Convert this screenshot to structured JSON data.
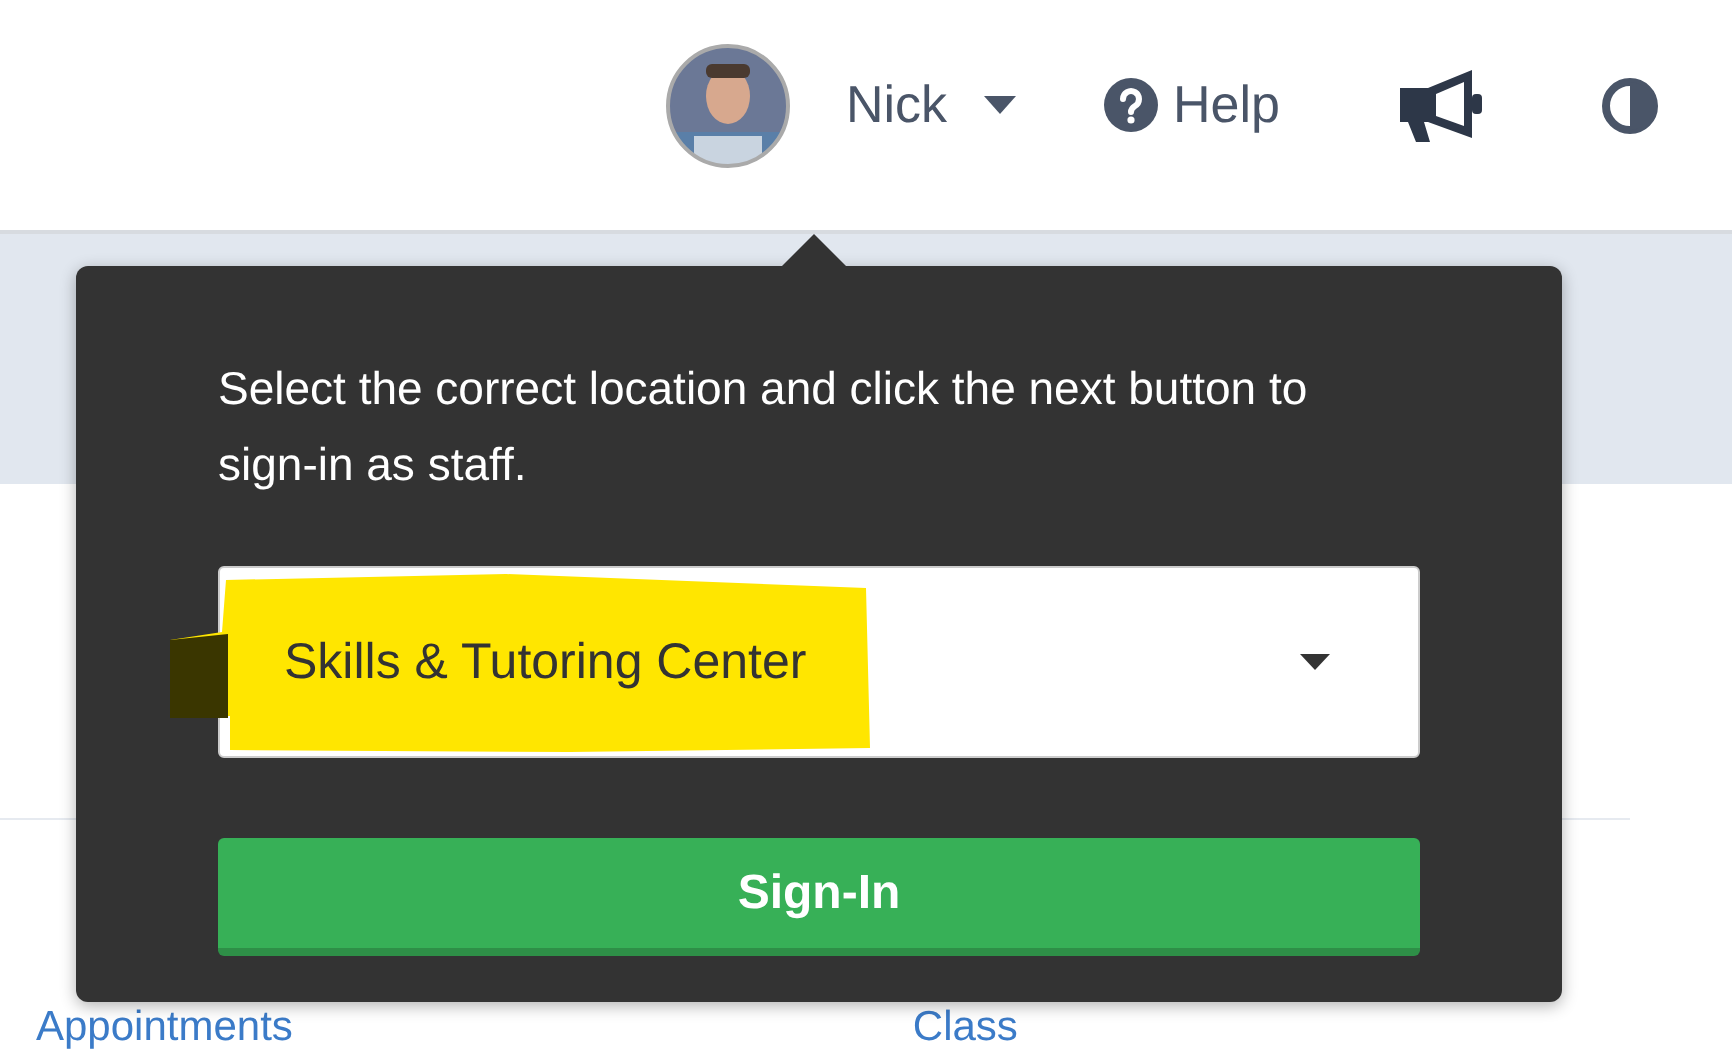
{
  "header": {
    "user": {
      "name": "Nick"
    },
    "help": {
      "label": "Help"
    }
  },
  "popup": {
    "message": "Select the correct location and click the next button to sign-in as staff.",
    "location_select": {
      "value": "Skills & Tutoring Center",
      "highlighted": true
    },
    "button": "Sign-In"
  },
  "page_links": [
    "Appointments",
    "Class"
  ]
}
